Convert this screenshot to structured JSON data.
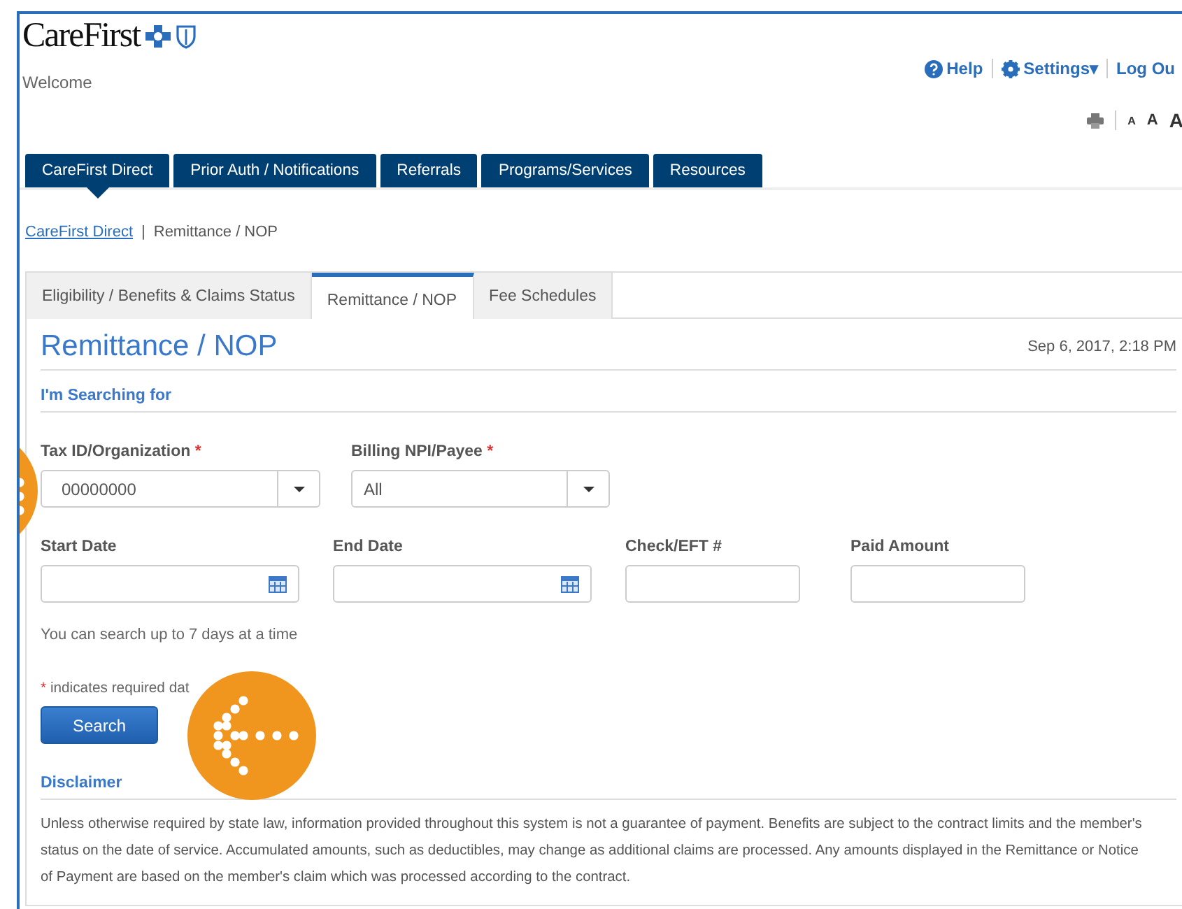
{
  "header": {
    "logo": "CareFirst",
    "welcome": "Welcome",
    "links": [
      {
        "kind": "help",
        "label": "Help"
      },
      {
        "kind": "settings",
        "label": "Settings▾"
      },
      {
        "kind": "plain",
        "label": "Log Ou"
      }
    ],
    "font_sizes": [
      "A",
      "A",
      "A"
    ]
  },
  "nav_tabs": [
    {
      "label": "CareFirst Direct",
      "selected": true
    },
    {
      "label": "Prior Auth / Notifications",
      "selected": false
    },
    {
      "label": "Referrals",
      "selected": false
    },
    {
      "label": "Programs/Services",
      "selected": false
    },
    {
      "label": "Resources",
      "selected": false
    }
  ],
  "breadcrumb": {
    "link": "CareFirst Direct",
    "separator": "|",
    "current": "Remittance / NOP"
  },
  "panel_tabs": [
    {
      "label": "Eligibility / Benefits & Claims Status",
      "selected": false
    },
    {
      "label": "Remittance / NOP",
      "selected": true
    },
    {
      "label": "Fee Schedules",
      "selected": false
    }
  ],
  "page_title": "Remittance / NOP",
  "timestamp": "Sep 6, 2017, 2:18 PM",
  "section_title": "I'm Searching for",
  "row1": [
    {
      "label": "Tax ID/Organization",
      "required": true,
      "kind": "select",
      "value": "00000000"
    },
    {
      "label": "Billing NPI/Payee",
      "required": true,
      "kind": "select",
      "value": "All"
    }
  ],
  "row2": [
    {
      "label": "Start Date",
      "required": false,
      "kind": "date"
    },
    {
      "label": "End Date",
      "required": false,
      "kind": "date"
    },
    {
      "label": "Check/EFT #",
      "required": false,
      "kind": "text"
    },
    {
      "label": "Paid Amount",
      "required": false,
      "kind": "text"
    }
  ],
  "hint": "You can search up to 7 days at a time",
  "required_mark": "*",
  "required_note": "indicates required dat",
  "search_button": "Search",
  "disclaimer": {
    "title": "Disclaimer",
    "text": "Unless otherwise required by state law, information provided throughout this system is not a guarantee of payment. Benefits are subject to the contract limits and the member's status on the date of service. Accumulated amounts, such as deductibles, may change as additional claims are processed. Any amounts displayed in the Remittance or Notice of Payment are based on the member's claim which was processed according to the contract."
  }
}
